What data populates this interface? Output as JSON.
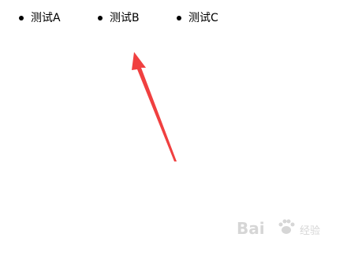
{
  "nav": {
    "items": [
      {
        "label": "测试A"
      },
      {
        "label": "测试B"
      },
      {
        "label": "测试C"
      }
    ]
  },
  "annotation": {
    "icon": "red-arrow-icon",
    "color": "#f04040"
  },
  "watermark": {
    "text": "Bai",
    "suffix": "经验",
    "icon": "paw-icon",
    "color": "#d6d6d6"
  }
}
